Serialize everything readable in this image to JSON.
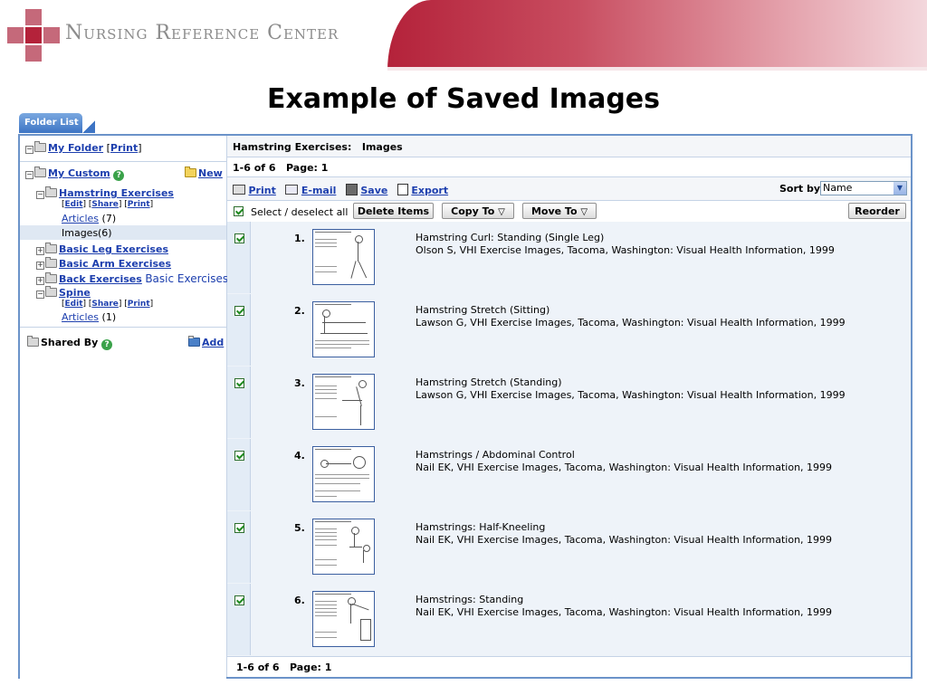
{
  "brand": {
    "name": "Nursing Reference Center"
  },
  "page_title": "Example of Saved Images",
  "tab_label": "Folder List",
  "sidebar": {
    "my_folder": {
      "label": "My Folder",
      "print": "Print"
    },
    "my_custom": {
      "label": "My Custom",
      "new_label": "New"
    },
    "hamstring": {
      "label": "Hamstring Exercises",
      "edit": "Edit",
      "share": "Share",
      "print": "Print",
      "articles_label": "Articles",
      "articles_count": "(7)",
      "images_label": "Images",
      "images_count": "(6)"
    },
    "basic_leg": "Basic Leg Exercises",
    "basic_arm": "Basic Arm Exercises",
    "back": "Back Exercises",
    "back_extra": "Basic Exercises",
    "spine": {
      "label": "Spine",
      "edit": "Edit",
      "share": "Share",
      "print": "Print",
      "articles_label": "Articles",
      "articles_count": "(1)"
    },
    "shared_by": {
      "label": "Shared By",
      "add": "Add"
    }
  },
  "main": {
    "heading": "Hamstring Exercises:   Images",
    "paging_top": "1-6 of 6   Page: 1",
    "toolbar": {
      "print": "Print",
      "email": "E-mail",
      "save": "Save",
      "export": "Export",
      "sort_by": "Sort by:",
      "sort_value": "Name"
    },
    "actions": {
      "select_all": "Select / deselect all",
      "delete": "Delete Items",
      "copy_to": "Copy To",
      "move_to": "Move To",
      "reorder": "Reorder"
    },
    "items": [
      {
        "num": "1.",
        "title": "Hamstring Curl: Standing (Single Leg)",
        "cite": "Olson S, VHI Exercise Images, Tacoma, Washington: Visual Health Information, 1999"
      },
      {
        "num": "2.",
        "title": "Hamstring Stretch (Sitting)",
        "cite": "Lawson G, VHI Exercise Images, Tacoma, Washington: Visual Health Information, 1999"
      },
      {
        "num": "3.",
        "title": "Hamstring Stretch (Standing)",
        "cite": "Lawson G, VHI Exercise Images, Tacoma, Washington: Visual Health Information, 1999"
      },
      {
        "num": "4.",
        "title": "Hamstrings / Abdominal Control",
        "cite": "Nail EK, VHI Exercise Images, Tacoma, Washington: Visual Health Information, 1999"
      },
      {
        "num": "5.",
        "title": "Hamstrings: Half-Kneeling",
        "cite": "Nail EK, VHI Exercise Images, Tacoma, Washington: Visual Health Information, 1999"
      },
      {
        "num": "6.",
        "title": "Hamstrings: Standing",
        "cite": "Nail EK, VHI Exercise Images, Tacoma, Washington: Visual Health Information, 1999"
      }
    ],
    "paging_bottom": "1-6 of 6   Page: 1"
  },
  "colors": {
    "brand_red": "#b4223a",
    "accent_blue": "#1d3fae",
    "frame_blue": "#6b93c9"
  }
}
